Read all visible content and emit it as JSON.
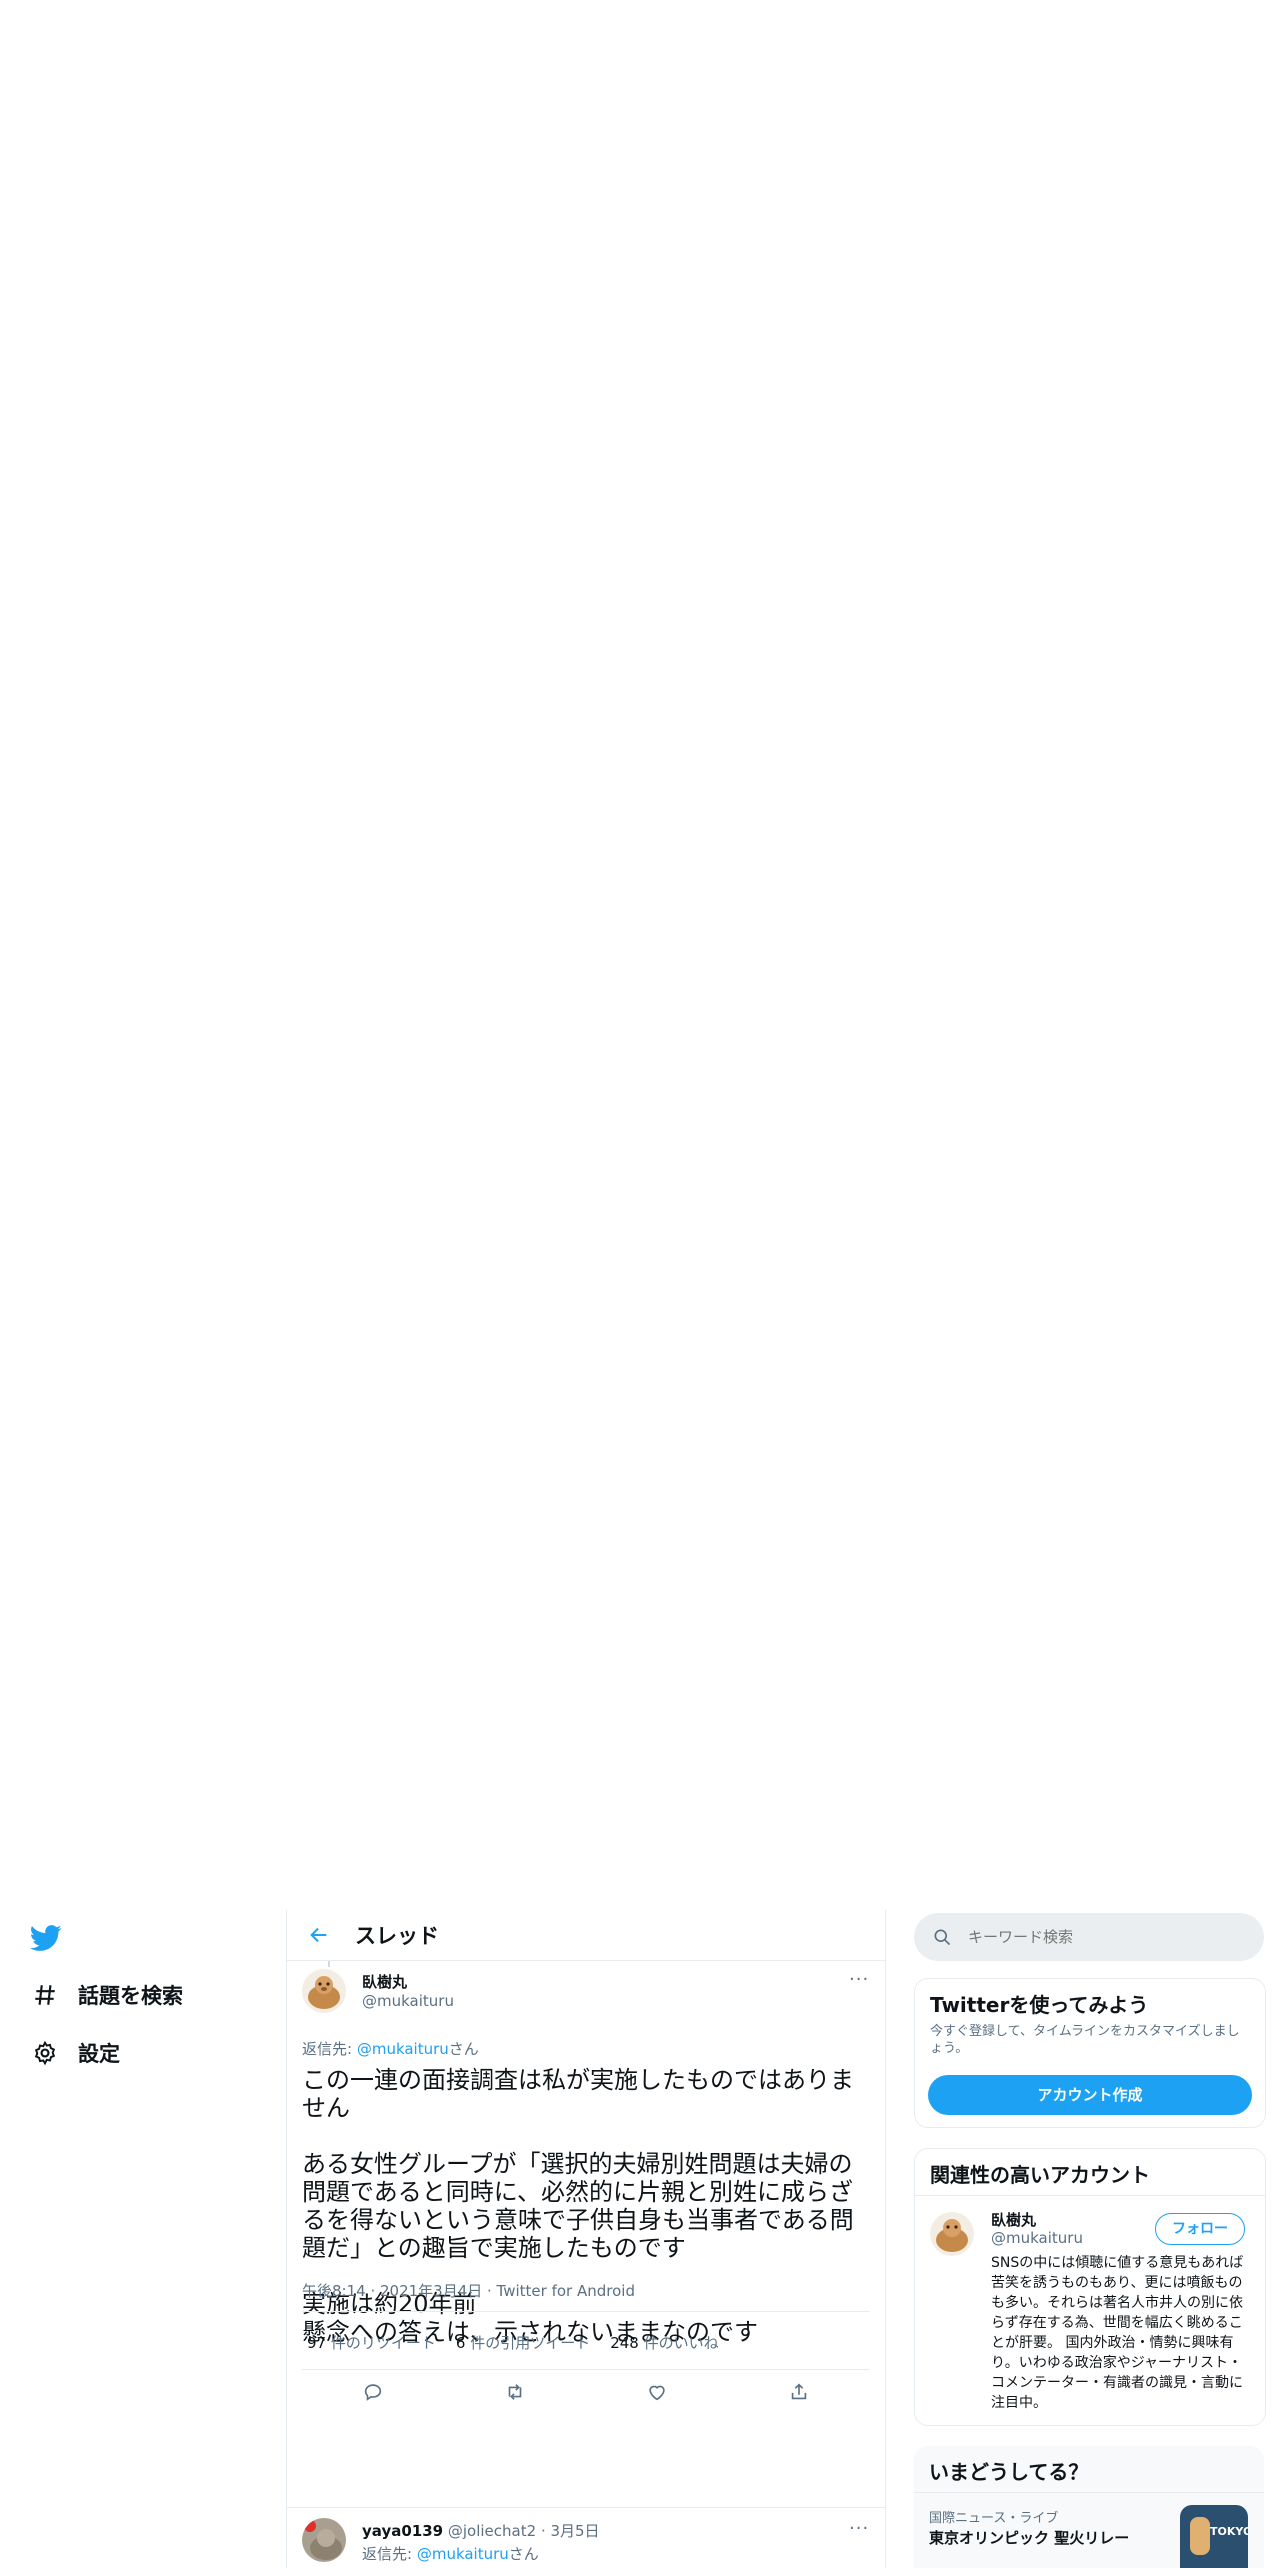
{
  "nav": {
    "explore_label": "話題を検索",
    "settings_label": "設定"
  },
  "thread": {
    "title": "スレッド"
  },
  "tweet": {
    "author_name": "臥樹丸",
    "author_handle": "@mukaituru",
    "reply_prefix": "返信先: ",
    "reply_to": "@mukaituru",
    "reply_suffix": "さん",
    "body": "この一連の面接調査は私が実施したものではありません\n\nある女性グループが「選択的夫婦別姓問題は夫婦の問題であると同時に、必然的に片親と別姓に成らざるを得ないという意味で子供自身も当事者である問題だ」との趣旨で実施したものです\n\n実施は約20年前\n懸念への答えは、示されないままなのです",
    "meta": "午後8:14 · 2021年3月4日 · Twitter for Android",
    "retweets_count": "97",
    "retweets_label": " 件のリツイート",
    "quotes_count": "6",
    "quotes_label": " 件の引用ツイート",
    "likes_count": "248",
    "likes_label": " 件のいいね"
  },
  "reply": {
    "author_name": "yaya0139",
    "author_handle": "@joliechat2",
    "date": "· 3月5日",
    "reply_prefix": "返信先: ",
    "reply_to": "@mukaituru",
    "reply_suffix": "さん"
  },
  "search": {
    "placeholder": "キーワード検索"
  },
  "signup_card": {
    "title": "Twitterを使ってみよう",
    "description": "今すぐ登録して、タイムラインをカスタマイズしましょう。",
    "button_label": "アカウント作成"
  },
  "related_card": {
    "title": "関連性の高いアカウント",
    "name": "臥樹丸",
    "handle": "@mukaituru",
    "follow_label": "フォロー",
    "bio": "SNSの中には傾聴に値する意見もあれば苦笑を誘うものもあり、更には噴飯ものも多い。それらは著名人市井人の別に依らず存在する為、世間を幅広く眺めることが肝要。 国内外政治・情勢に興味有り。いわゆる政治家やジャーナリスト・コメンテーター・有識者の識見・言動に注目中。"
  },
  "trends_card": {
    "title": "いまどうしてる？",
    "category": "国際ニュース・ライブ",
    "headline": "東京オリンピック 聖火リレー",
    "thumb_text": "TOKYO"
  },
  "colors": {
    "accent": "#1da1f2",
    "text": "#0f1419",
    "secondary_text": "#5b7083",
    "border": "#e6ecf0"
  }
}
